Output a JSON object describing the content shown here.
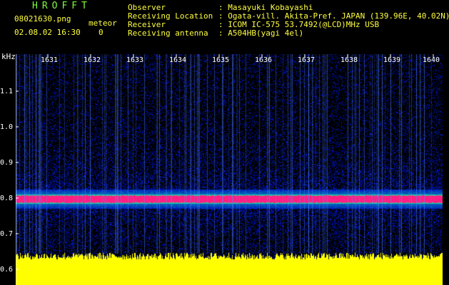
{
  "header": {
    "brand": "HROFFT",
    "filename": "08021630.png",
    "meteor_label": "meteor",
    "datetime": "02.08.02 16:30",
    "meteor_count": "0"
  },
  "info": [
    {
      "label": "Observer",
      "value": ": Masayuki Kobayashi"
    },
    {
      "label": "Receiving Location",
      "value": ": Ogata-vill. Akita-Pref. JAPAN (139.96E, 40.02N)"
    },
    {
      "label": "Receiver",
      "value": ": ICOM IC-575 53.7492(@LCD)MHz USB"
    },
    {
      "label": "Receiving antenna",
      "value": ": A504HB(yagi 4el)"
    }
  ],
  "axis": {
    "unit": "kHz",
    "y_ticks": [
      "1.1",
      "1.0",
      "0.9",
      "0.8",
      "0.7",
      "0.6"
    ],
    "x_ticks": [
      "1631",
      "1632",
      "1633",
      "1634",
      "1635",
      "1636",
      "1637",
      "1638",
      "1639",
      "1640"
    ]
  },
  "colors": {
    "background": "#000000",
    "title_green": "#7cff3a",
    "info_cyan": "#6fe8ff",
    "filename_yellow": "#ffff40",
    "signal_band": "#ff2080",
    "level_bars": "#ffff00"
  }
}
